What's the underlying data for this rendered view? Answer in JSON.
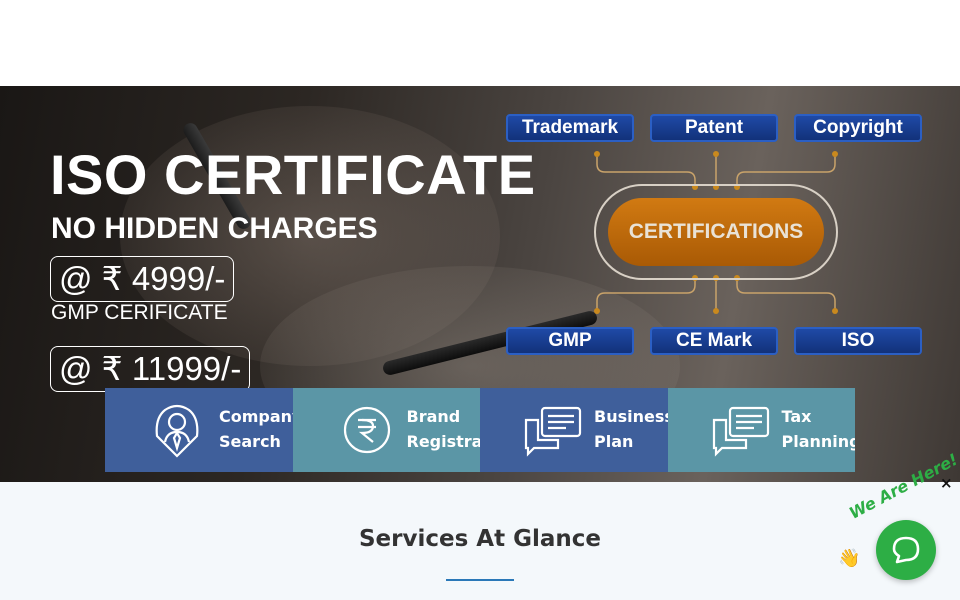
{
  "hero": {
    "title": "ISO CERTIFICATE",
    "subtitle": "NO HIDDEN CHARGES",
    "price_primary": "@ ₹ 4999/-",
    "secondary_label": "GMP CERIFICATE",
    "price_secondary": "@ ₹ 11999/-"
  },
  "diagram": {
    "top_pills": [
      "Trademark",
      "Patent",
      "Copyright"
    ],
    "center": "CERTIFICATIONS",
    "bottom_pills": [
      "GMP",
      "CE Mark",
      "ISO"
    ]
  },
  "services": [
    {
      "line1": "Company",
      "line2": "Search",
      "icon": "person-tie-icon"
    },
    {
      "line1": "Brand",
      "line2": "Registration",
      "icon": "rupee-icon"
    },
    {
      "line1": "Business",
      "line2": "Plan",
      "icon": "chat-document-icon"
    },
    {
      "line1": "Tax",
      "line2": "Planning",
      "icon": "chat-document-icon"
    }
  ],
  "glance": {
    "title": "Services At Glance"
  },
  "chat": {
    "tagline": "We Are Here!",
    "close": "×"
  },
  "colors": {
    "service_blue": "#3f5f9b",
    "service_teal": "#5b96a6",
    "chat_green": "#2dae45",
    "cert_orange": "#d17a12",
    "pill_blue": "#1f4aa6"
  }
}
